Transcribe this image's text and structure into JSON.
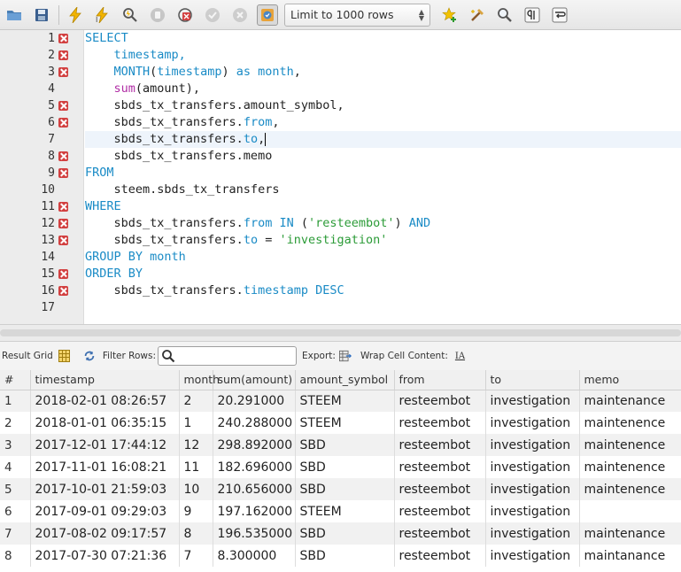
{
  "toolbar": {
    "limit_select": {
      "value": "Limit to 1000 rows"
    },
    "icons": [
      "folder-icon",
      "save-icon",
      "execute-icon",
      "execute-current-icon",
      "explain-icon",
      "stop-icon",
      "toggle-error-icon",
      "commit-icon",
      "rollback-icon",
      "autocommit-icon",
      "add-snippet-icon",
      "beautify-icon",
      "find-icon",
      "invisible-chars-icon",
      "wrap-lines-icon"
    ]
  },
  "editor": {
    "lines": [
      {
        "number": "1",
        "marker": "error",
        "segments": [
          {
            "text": "SELECT",
            "style": "kw"
          }
        ]
      },
      {
        "number": "2",
        "marker": "error",
        "segments": [
          {
            "text": "    timestamp,",
            "style": "kw"
          }
        ]
      },
      {
        "number": "3",
        "marker": "error",
        "segments": [
          {
            "text": "    ",
            "style": ""
          },
          {
            "text": "MONTH",
            "style": "kw"
          },
          {
            "text": "(",
            "style": ""
          },
          {
            "text": "timestamp",
            "style": "kw"
          },
          {
            "text": ") ",
            "style": ""
          },
          {
            "text": "as month",
            "style": "kw"
          },
          {
            "text": ",",
            "style": ""
          }
        ]
      },
      {
        "number": "4",
        "marker": "none",
        "segments": [
          {
            "text": "    ",
            "style": ""
          },
          {
            "text": "sum",
            "style": "fn"
          },
          {
            "text": "(amount),",
            "style": ""
          }
        ]
      },
      {
        "number": "5",
        "marker": "error",
        "segments": [
          {
            "text": "    sbds_tx_transfers.amount_symbol,",
            "style": ""
          }
        ]
      },
      {
        "number": "6",
        "marker": "error",
        "segments": [
          {
            "text": "    sbds_tx_transfers.",
            "style": ""
          },
          {
            "text": "from",
            "style": "kw"
          },
          {
            "text": ",",
            "style": ""
          }
        ]
      },
      {
        "number": "7",
        "marker": "none",
        "current": true,
        "segments": [
          {
            "text": "    sbds_tx_transfers.",
            "style": ""
          },
          {
            "text": "to",
            "style": "kw"
          },
          {
            "text": ",",
            "style": ""
          }
        ]
      },
      {
        "number": "8",
        "marker": "error",
        "segments": [
          {
            "text": "    sbds_tx_transfers.memo",
            "style": ""
          }
        ]
      },
      {
        "number": "9",
        "marker": "error",
        "segments": [
          {
            "text": "FROM",
            "style": "kw"
          }
        ]
      },
      {
        "number": "10",
        "marker": "none",
        "segments": [
          {
            "text": "    steem.sbds_tx_transfers",
            "style": ""
          }
        ]
      },
      {
        "number": "11",
        "marker": "error",
        "segments": [
          {
            "text": "WHERE",
            "style": "kw"
          }
        ]
      },
      {
        "number": "12",
        "marker": "error",
        "segments": [
          {
            "text": "    sbds_tx_transfers.",
            "style": ""
          },
          {
            "text": "from IN",
            "style": "kw"
          },
          {
            "text": " (",
            "style": ""
          },
          {
            "text": "'resteembot'",
            "style": "str"
          },
          {
            "text": ") ",
            "style": ""
          },
          {
            "text": "AND",
            "style": "kw"
          }
        ]
      },
      {
        "number": "13",
        "marker": "error",
        "segments": [
          {
            "text": "    sbds_tx_transfers.",
            "style": ""
          },
          {
            "text": "to",
            "style": "kw"
          },
          {
            "text": " = ",
            "style": ""
          },
          {
            "text": "'investigation'",
            "style": "str"
          }
        ]
      },
      {
        "number": "14",
        "marker": "none",
        "segments": [
          {
            "text": "GROUP BY month",
            "style": "kw"
          }
        ]
      },
      {
        "number": "15",
        "marker": "error",
        "segments": [
          {
            "text": "ORDER BY",
            "style": "kw"
          }
        ]
      },
      {
        "number": "16",
        "marker": "error",
        "segments": [
          {
            "text": "    sbds_tx_transfers.",
            "style": ""
          },
          {
            "text": "timestamp DESC",
            "style": "kw"
          }
        ]
      },
      {
        "number": "17",
        "marker": "none",
        "segments": []
      }
    ]
  },
  "results_bar": {
    "result_grid_label": "Result Grid",
    "filter_rows_label": "Filter Rows:",
    "filter_value": "",
    "export_label": "Export:",
    "wrap_label": "Wrap Cell Content:",
    "wrap_icon_text": "IA"
  },
  "grid": {
    "columns": [
      "#",
      "timestamp",
      "month",
      "sum(amount)",
      "amount_symbol",
      "from",
      "to",
      "memo"
    ],
    "rows": [
      [
        "1",
        "2018-02-01 08:26:57",
        "2",
        "20.291000",
        "STEEM",
        "resteembot",
        "investigation",
        "maintenance"
      ],
      [
        "2",
        "2018-01-01 06:35:15",
        "1",
        "240.288000",
        "STEEM",
        "resteembot",
        "investigation",
        "maintenence"
      ],
      [
        "3",
        "2017-12-01 17:44:12",
        "12",
        "298.892000",
        "SBD",
        "resteembot",
        "investigation",
        "maintenence"
      ],
      [
        "4",
        "2017-11-01 16:08:21",
        "11",
        "182.696000",
        "SBD",
        "resteembot",
        "investigation",
        "maintenence"
      ],
      [
        "5",
        "2017-10-01 21:59:03",
        "10",
        "210.656000",
        "SBD",
        "resteembot",
        "investigation",
        "maintenence"
      ],
      [
        "6",
        "2017-09-01 09:29:03",
        "9",
        "197.162000",
        "STEEM",
        "resteembot",
        "investigation",
        ""
      ],
      [
        "7",
        "2017-08-02 09:17:57",
        "8",
        "196.535000",
        "SBD",
        "resteembot",
        "investigation",
        "maintenance"
      ],
      [
        "8",
        "2017-07-30 07:21:36",
        "7",
        "8.300000",
        "SBD",
        "resteembot",
        "investigation",
        "maintanance"
      ]
    ]
  }
}
